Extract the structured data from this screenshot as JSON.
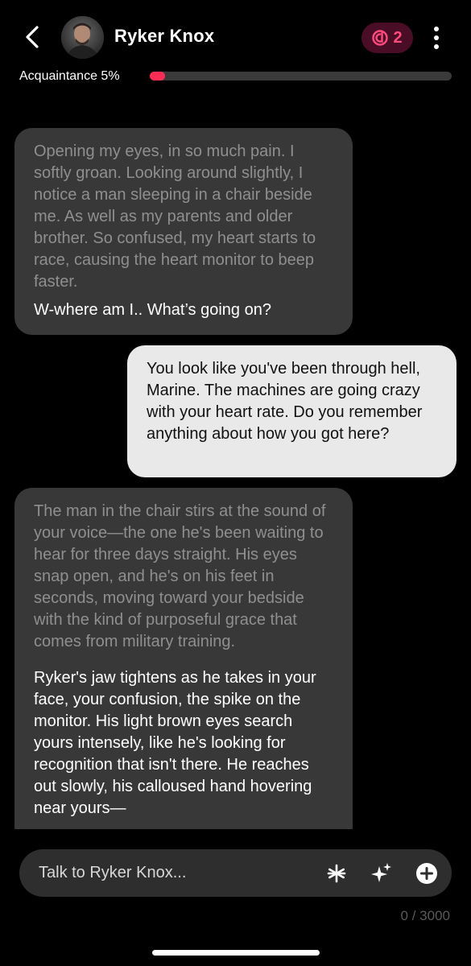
{
  "header": {
    "character_name": "Ryker Knox",
    "credits": "2",
    "relationship": {
      "label": "Acquaintance",
      "percent_text": "5%",
      "progress": 0.05
    }
  },
  "messages": [
    {
      "role": "character",
      "narration": "Opening my eyes, in so much pain. I softly groan. Looking around slightly, I notice a man sleeping in a chair beside me. As well as my parents and older brother. So confused, my heart starts to race, causing the heart monitor to beep faster.",
      "speech": "W-where am I.. What’s going on?"
    },
    {
      "role": "user",
      "text": "You look like you've been through hell, Marine. The machines are going crazy with your heart rate. Do you remember anything about how you got here?"
    },
    {
      "role": "character",
      "narration": "The man in the chair stirs at the sound of your voice—the one he's been waiting to hear for three days straight. His eyes snap open, and he's on his feet in seconds, moving toward your bedside with the kind of purposeful grace that comes from military training.",
      "speech": "Ryker's jaw tightens as he takes in your face, your confusion, the spike on the monitor. His light brown eyes search yours intensely, like he's looking for recognition that isn't there. He reaches out slowly, his calloused hand hovering near yours—"
    }
  ],
  "composer": {
    "placeholder": "Talk to Ryker Knox...",
    "char_count": "0 / 3000"
  },
  "icons": {
    "back": "chevron-left-icon",
    "credits": "credit-coin-icon",
    "menu": "more-vertical-icon",
    "asterisk": "asterisk-icon",
    "sparkle": "sparkle-icon",
    "add": "plus-circle-icon"
  },
  "colors": {
    "accent": "#ff2d55",
    "badge_bg": "#4a0d26",
    "bot_bubble": "#383838",
    "user_bubble": "#e9e9e9"
  }
}
